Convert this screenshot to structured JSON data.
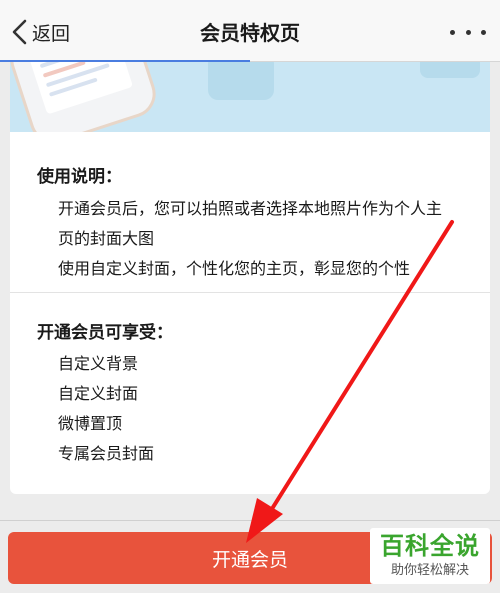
{
  "navbar": {
    "back_label": "返回",
    "title": "会员特权页",
    "progress_percent": 50
  },
  "usage": {
    "title": "使用说明：",
    "lines": [
      "开通会员后，您可以拍照或者选择本地照片作为个人主",
      "页的封面大图",
      "使用自定义封面，个性化您的主页，彰显您的个性"
    ]
  },
  "benefits": {
    "title": "开通会员可享受：",
    "items": [
      "自定义背景",
      "自定义封面",
      "微博置顶",
      "专属会员封面"
    ]
  },
  "bottom": {
    "open_button_label": "开通会员"
  },
  "watermark": {
    "main": "百科全说",
    "sub": "助你轻松解决"
  },
  "colors": {
    "accent_button": "#e8533c",
    "annotation_arrow": "#f01818",
    "watermark_green": "#3aa52e",
    "nav_progress": "#4a7de0"
  },
  "icons": {
    "back": "chevron-left-icon",
    "more": "more-dots-icon"
  }
}
